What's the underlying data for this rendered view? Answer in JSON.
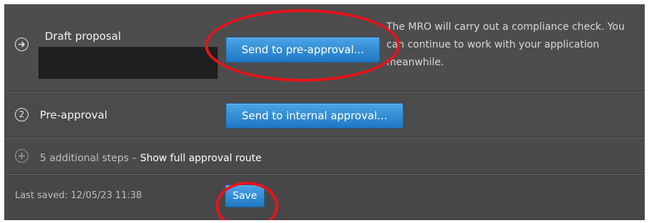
{
  "steps": {
    "draft": {
      "title": "Draft proposal",
      "button": "Send to pre-approval...",
      "description": "The MRO will carry out a compliance check. You can continue to work with your application meanwhile."
    },
    "pre_approval": {
      "number": "2",
      "title": "Pre-approval",
      "button": "Send to internal approval..."
    },
    "more": {
      "text": "5 additional steps – ",
      "link": "Show full approval route"
    }
  },
  "footer": {
    "last_saved": "Last saved: 12/05/23 11:38",
    "save_button": "Save"
  },
  "icons": {
    "current_step": "arrow-right-circle-icon",
    "expand": "plus-circle-icon"
  },
  "colors": {
    "accent_blue": "#2a86d1",
    "annotation_red": "#e8131b",
    "panel_bg": "#4a4a4a"
  }
}
